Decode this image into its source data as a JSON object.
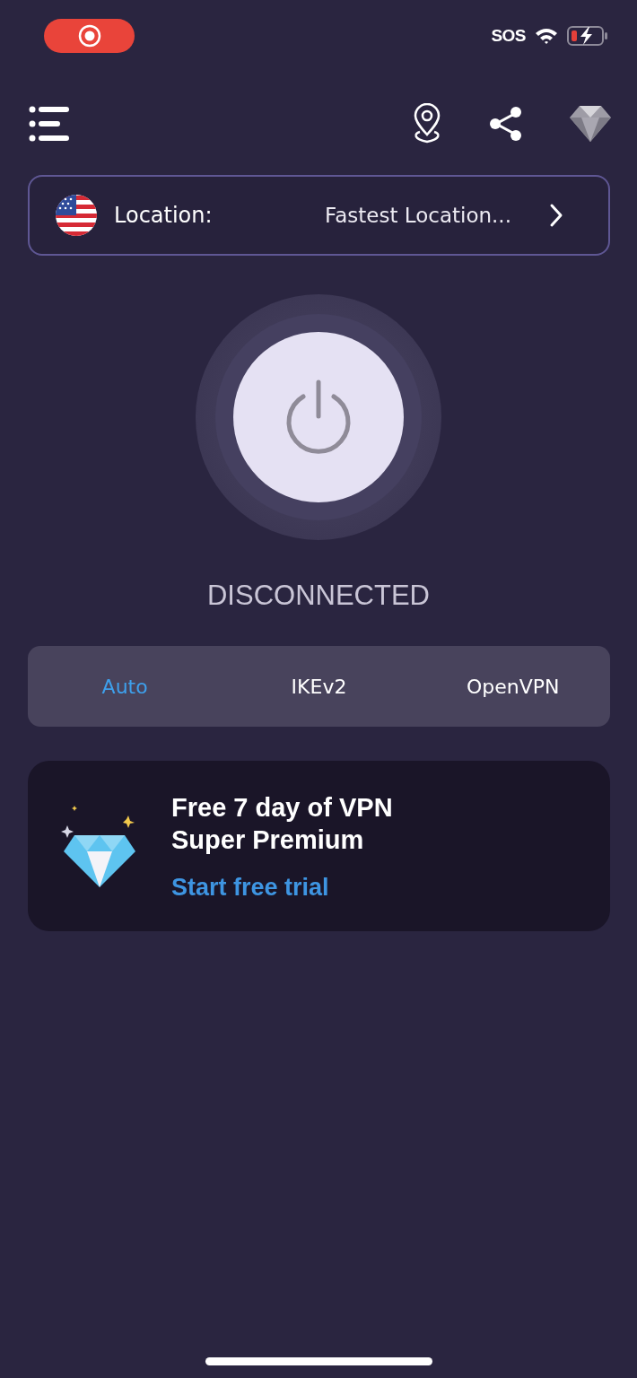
{
  "status_bar": {
    "network": "SOS"
  },
  "location": {
    "label": "Location:",
    "value": "Fastest Location..."
  },
  "connection_status": "DISCONNECTED",
  "protocols": [
    {
      "label": "Auto",
      "selected": true
    },
    {
      "label": "IKEv2",
      "selected": false
    },
    {
      "label": "OpenVPN",
      "selected": false
    }
  ],
  "promo": {
    "title": "Free 7 day of VPN Super Premium",
    "link": "Start free trial"
  }
}
